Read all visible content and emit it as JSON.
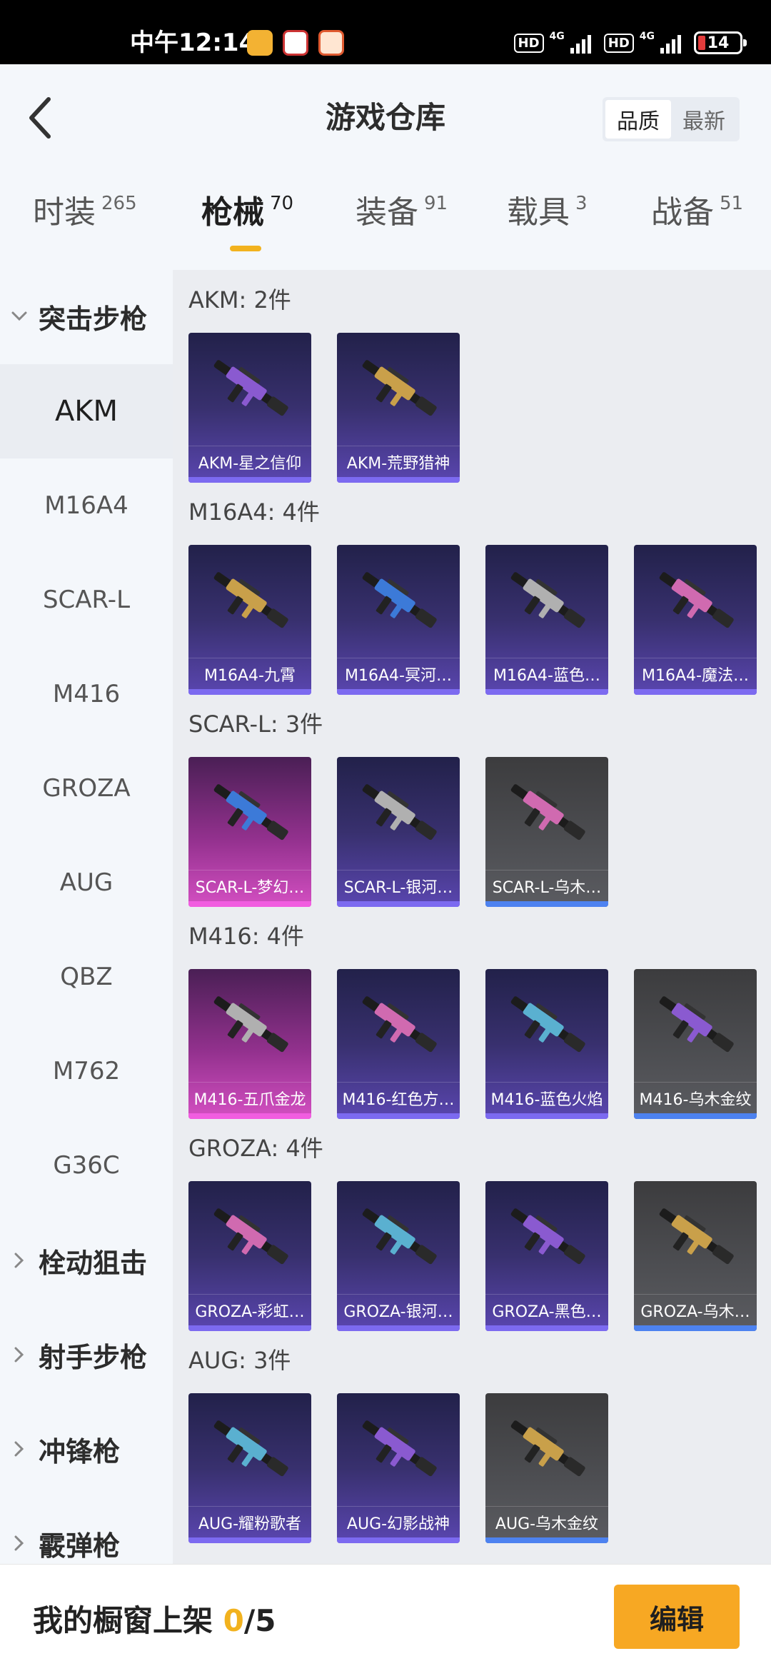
{
  "status_bar": {
    "time": "中午12:14",
    "hd1": "HD",
    "net1": "4G",
    "hd2": "HD",
    "net2": "4G",
    "battery": "14",
    "battery_color": "#e23b3b"
  },
  "header": {
    "title": "游戏仓库",
    "sort_options": [
      "品质",
      "最新"
    ],
    "selected_sort": "品质"
  },
  "tabs": [
    {
      "label": "时装",
      "count": "265"
    },
    {
      "label": "枪械",
      "count": "70"
    },
    {
      "label": "装备",
      "count": "91"
    },
    {
      "label": "载具",
      "count": "3"
    },
    {
      "label": "战备",
      "count": "51"
    }
  ],
  "active_tab": "枪械",
  "sidebar": {
    "expanded_group": "突击步枪",
    "items": [
      "AKM",
      "M16A4",
      "SCAR-L",
      "M416",
      "GROZA",
      "AUG",
      "QBZ",
      "M762",
      "G36C"
    ],
    "selected_item": "AKM",
    "collapsed_groups": [
      "栓动狙击",
      "射手步枪",
      "冲锋枪",
      "霰弹枪"
    ]
  },
  "sections": [
    {
      "title": "AKM: 2件",
      "cards": [
        {
          "name": "AKM-星之信仰",
          "rarity": "purple"
        },
        {
          "name": "AKM-荒野猎神",
          "rarity": "purple"
        }
      ]
    },
    {
      "title": "M16A4: 4件",
      "cards": [
        {
          "name": "M16A4-九霄",
          "rarity": "purple"
        },
        {
          "name": "M16A4-冥河…",
          "rarity": "purple"
        },
        {
          "name": "M16A4-蓝色…",
          "rarity": "purple"
        },
        {
          "name": "M16A4-魔法…",
          "rarity": "purple"
        }
      ]
    },
    {
      "title": "SCAR-L: 3件",
      "cards": [
        {
          "name": "SCAR-L-梦幻…",
          "rarity": "pink"
        },
        {
          "name": "SCAR-L-银河…",
          "rarity": "purple"
        },
        {
          "name": "SCAR-L-乌木…",
          "rarity": "gray"
        }
      ]
    },
    {
      "title": "M416: 4件",
      "cards": [
        {
          "name": "M416-五爪金龙",
          "rarity": "pink"
        },
        {
          "name": "M416-红色方…",
          "rarity": "purple"
        },
        {
          "name": "M416-蓝色火焰",
          "rarity": "purple"
        },
        {
          "name": "M416-乌木金纹",
          "rarity": "gray"
        }
      ]
    },
    {
      "title": "GROZA: 4件",
      "cards": [
        {
          "name": "GROZA-彩虹…",
          "rarity": "purple"
        },
        {
          "name": "GROZA-银河…",
          "rarity": "purple"
        },
        {
          "name": "GROZA-黑色…",
          "rarity": "purple"
        },
        {
          "name": "GROZA-乌木…",
          "rarity": "gray"
        }
      ]
    },
    {
      "title": "AUG: 3件",
      "cards": [
        {
          "name": "AUG-耀粉歌者",
          "rarity": "purple"
        },
        {
          "name": "AUG-幻影战神",
          "rarity": "purple"
        },
        {
          "name": "AUG-乌木金纹",
          "rarity": "gray"
        }
      ]
    }
  ],
  "bottom_bar": {
    "label": "我的橱窗上架 ",
    "current": "0",
    "separator": "/",
    "total": "5",
    "edit_label": "编辑",
    "accent_color": "#f7a823"
  }
}
